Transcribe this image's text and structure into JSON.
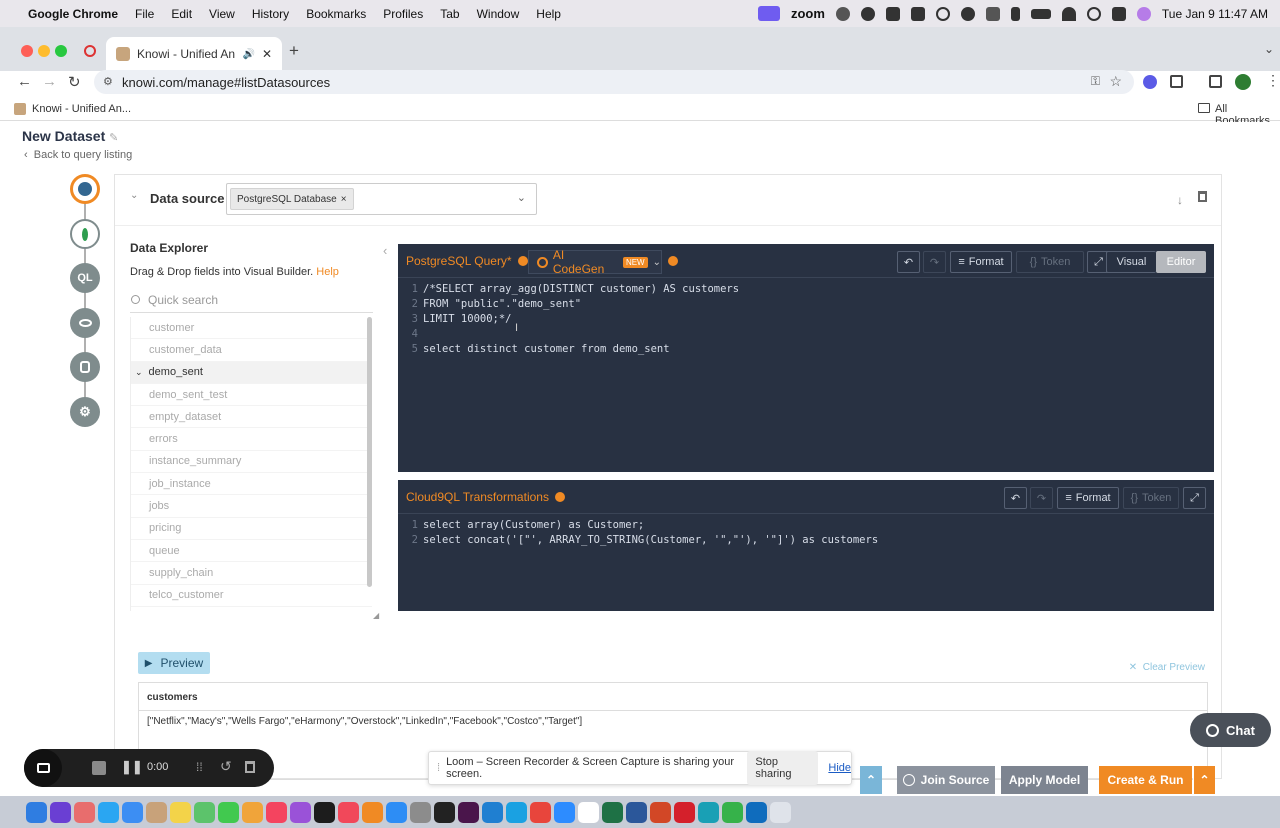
{
  "menubar": {
    "app_name": "Google Chrome",
    "items": [
      "File",
      "Edit",
      "View",
      "History",
      "Bookmarks",
      "Profiles",
      "Tab",
      "Window",
      "Help"
    ],
    "zoom_label": "zoom",
    "datetime": "Tue Jan 9  11:47 AM"
  },
  "browser": {
    "tab_title": "Knowi - Unified Analytics",
    "url": "knowi.com/manage#listDatasources",
    "bookmark": "Knowi - Unified An...",
    "all_bookmarks": "All Bookmarks"
  },
  "page": {
    "title": "New Dataset",
    "back_link": "Back to query listing"
  },
  "steps": [
    "",
    "",
    "QL",
    "",
    "",
    ""
  ],
  "datasource": {
    "label": "Data source",
    "selected": "PostgreSQL Database"
  },
  "explorer": {
    "title": "Data Explorer",
    "subtitle": "Drag & Drop fields into Visual Builder.",
    "help": "Help",
    "search_placeholder": "Quick search",
    "tables": [
      "customer",
      "customer_data",
      "demo_sent",
      "demo_sent_test",
      "empty_dataset",
      "errors",
      "instance_summary",
      "job_instance",
      "jobs",
      "pricing",
      "queue",
      "supply_chain",
      "telco_customer"
    ],
    "open_table": "demo_sent"
  },
  "query_editor": {
    "title": "PostgreSQL Query*",
    "codegen_label": "AI CodeGen",
    "codegen_badge": "NEW",
    "format_label": "Format",
    "token_label": "Token",
    "visual_tab": "Visual",
    "editor_tab": "Editor",
    "line_numbers": [
      "1",
      "2",
      "3",
      "4",
      "5"
    ],
    "lines": [
      "/*SELECT array_agg(DISTINCT customer) AS customers",
      "FROM \"public\".\"demo_sent\"",
      "LIMIT 10000;*/",
      "",
      "select distinct customer from demo_sent"
    ]
  },
  "transform_editor": {
    "title": "Cloud9QL Transformations",
    "format_label": "Format",
    "token_label": "Token",
    "line_numbers": [
      "1",
      "2"
    ],
    "lines": [
      "select array(Customer) as Customer;",
      "select concat('[\"', ARRAY_TO_STRING(Customer, '\",\"'), '\"]') as customers"
    ]
  },
  "preview": {
    "button": "Preview",
    "clear": "Clear Preview",
    "column": "customers",
    "row": "[\"Netflix\",\"Macy's\",\"Wells Fargo\",\"eHarmony\",\"Overstock\",\"LinkedIn\",\"Facebook\",\"Costco\",\"Target\"]"
  },
  "chat": {
    "label": "Chat"
  },
  "actions": {
    "join_source": "Join Source",
    "apply_model": "Apply Model",
    "create_run": "Create & Run"
  },
  "loom": {
    "timer": "0:00",
    "banner": "Loom – Screen Recorder & Screen Capture is sharing your screen.",
    "stop": "Stop sharing",
    "hide": "Hide"
  },
  "colors": {
    "accent_orange": "#f08a24",
    "editor_bg": "#283142",
    "apply_model_bg": "#7d8490",
    "join_source_bg": "#8c939e",
    "create_run_bg": "#f08a24"
  }
}
